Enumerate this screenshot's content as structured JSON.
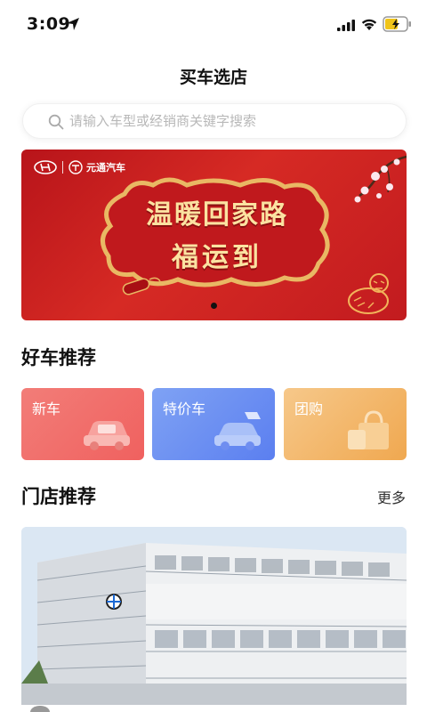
{
  "status_bar": {
    "time": "3:09",
    "icons": [
      "location-arrow-icon",
      "cellular-signal-icon",
      "wifi-icon",
      "battery-charging-icon"
    ]
  },
  "header": {
    "title": "买车选店"
  },
  "search": {
    "placeholder": "请输入车型或经销商关键字搜索"
  },
  "banner": {
    "brand_text": "元通汽车",
    "line1": "温暖回家路",
    "line2": "福运到",
    "colors": {
      "background": "#c81e22",
      "text": "#fbe2a1"
    }
  },
  "recommend_cars": {
    "title": "好车推荐",
    "cards": [
      {
        "label": "新车",
        "icon": "car-icon",
        "color": "#f0615f"
      },
      {
        "label": "特价车",
        "icon": "sale-car-icon",
        "color": "#5b7ff0"
      },
      {
        "label": "团购",
        "icon": "shopping-bag-icon",
        "color": "#f0a850"
      }
    ]
  },
  "recommend_stores": {
    "title": "门店推荐",
    "more": "更多"
  }
}
